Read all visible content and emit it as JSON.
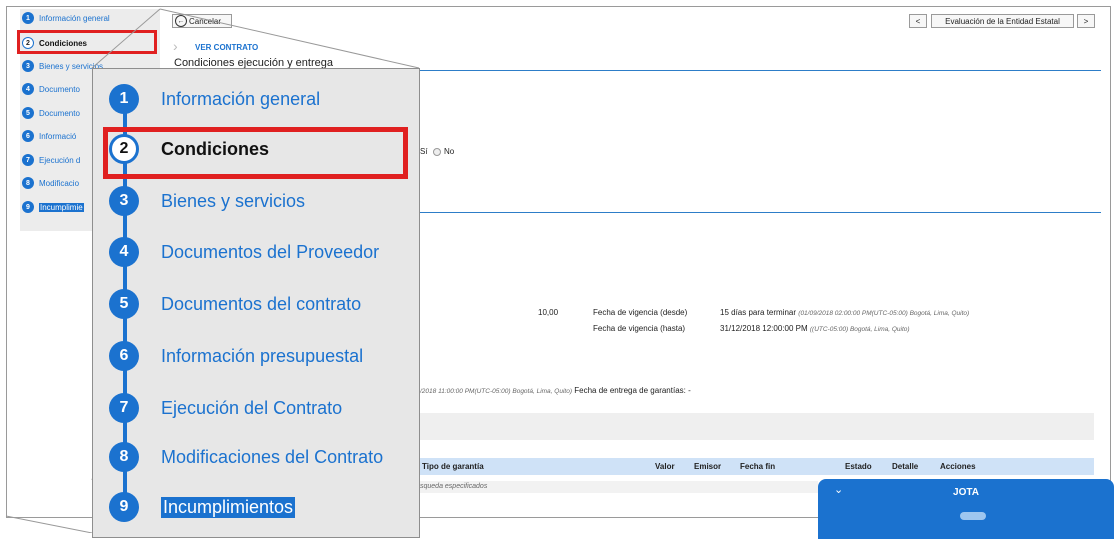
{
  "sidebar": {
    "items": [
      {
        "num": "1",
        "label": "Información general"
      },
      {
        "num": "2",
        "label": "Condiciones"
      },
      {
        "num": "3",
        "label": "Bienes y servicios"
      },
      {
        "num": "4",
        "label": "Documento"
      },
      {
        "num": "5",
        "label": "Documento"
      },
      {
        "num": "6",
        "label": "Informació"
      },
      {
        "num": "7",
        "label": "Ejecución d"
      },
      {
        "num": "8",
        "label": "Modificacio"
      },
      {
        "num": "9",
        "label": "Incumplimie"
      }
    ]
  },
  "toolbar": {
    "cancel_label": "Cancelar",
    "prev_label": "<",
    "eval_label": "Evaluación de la Entidad Estatal",
    "next_label": ">"
  },
  "header": {
    "breadcrumb": "VER CONTRATO",
    "section_title": "Condiciones ejecución y entrega"
  },
  "content": {
    "radio_yes": "Sí",
    "radio_no": "No",
    "value": "10,00",
    "vig_desde_label": "Fecha de vigencia (desde)",
    "vig_desde_value": "15 días para terminar",
    "vig_desde_detail": "(01/09/2018 02:00:00 PM(UTC-05:00) Bogotá, Lima, Quito)",
    "vig_hasta_label": "Fecha de vigencia (hasta)",
    "vig_hasta_value": "31/12/2018 12:00:00 PM",
    "vig_hasta_detail": "((UTC-05:00) Bogotá, Lima, Quito)",
    "partial_date": "/2018 11:00:00 PM(UTC-05:00) Bogotá, Lima, Quito)",
    "garantias_label": "Fecha de entrega de garantías: -"
  },
  "table": {
    "columns": [
      "Tipo de garantía",
      "Valor",
      "Emisor",
      "Fecha fin",
      "Estado",
      "Detalle",
      "Acciones"
    ],
    "empty_text": "squeda especificados"
  },
  "chat": {
    "title": "JOTA"
  },
  "zoom": {
    "items": [
      {
        "num": "1",
        "label": "Información general"
      },
      {
        "num": "2",
        "label": "Condiciones"
      },
      {
        "num": "3",
        "label": "Bienes y servicios"
      },
      {
        "num": "4",
        "label": "Documentos del Proveedor"
      },
      {
        "num": "5",
        "label": "Documentos del contrato"
      },
      {
        "num": "6",
        "label": "Información presupuestal"
      },
      {
        "num": "7",
        "label": "Ejecución del Contrato"
      },
      {
        "num": "8",
        "label": "Modificaciones del Contrato"
      },
      {
        "num": "9",
        "label": "Incumplimientos"
      }
    ]
  },
  "colors": {
    "accent": "#1b72cf",
    "highlight": "#e02020",
    "table_header": "#cfe2f7"
  }
}
